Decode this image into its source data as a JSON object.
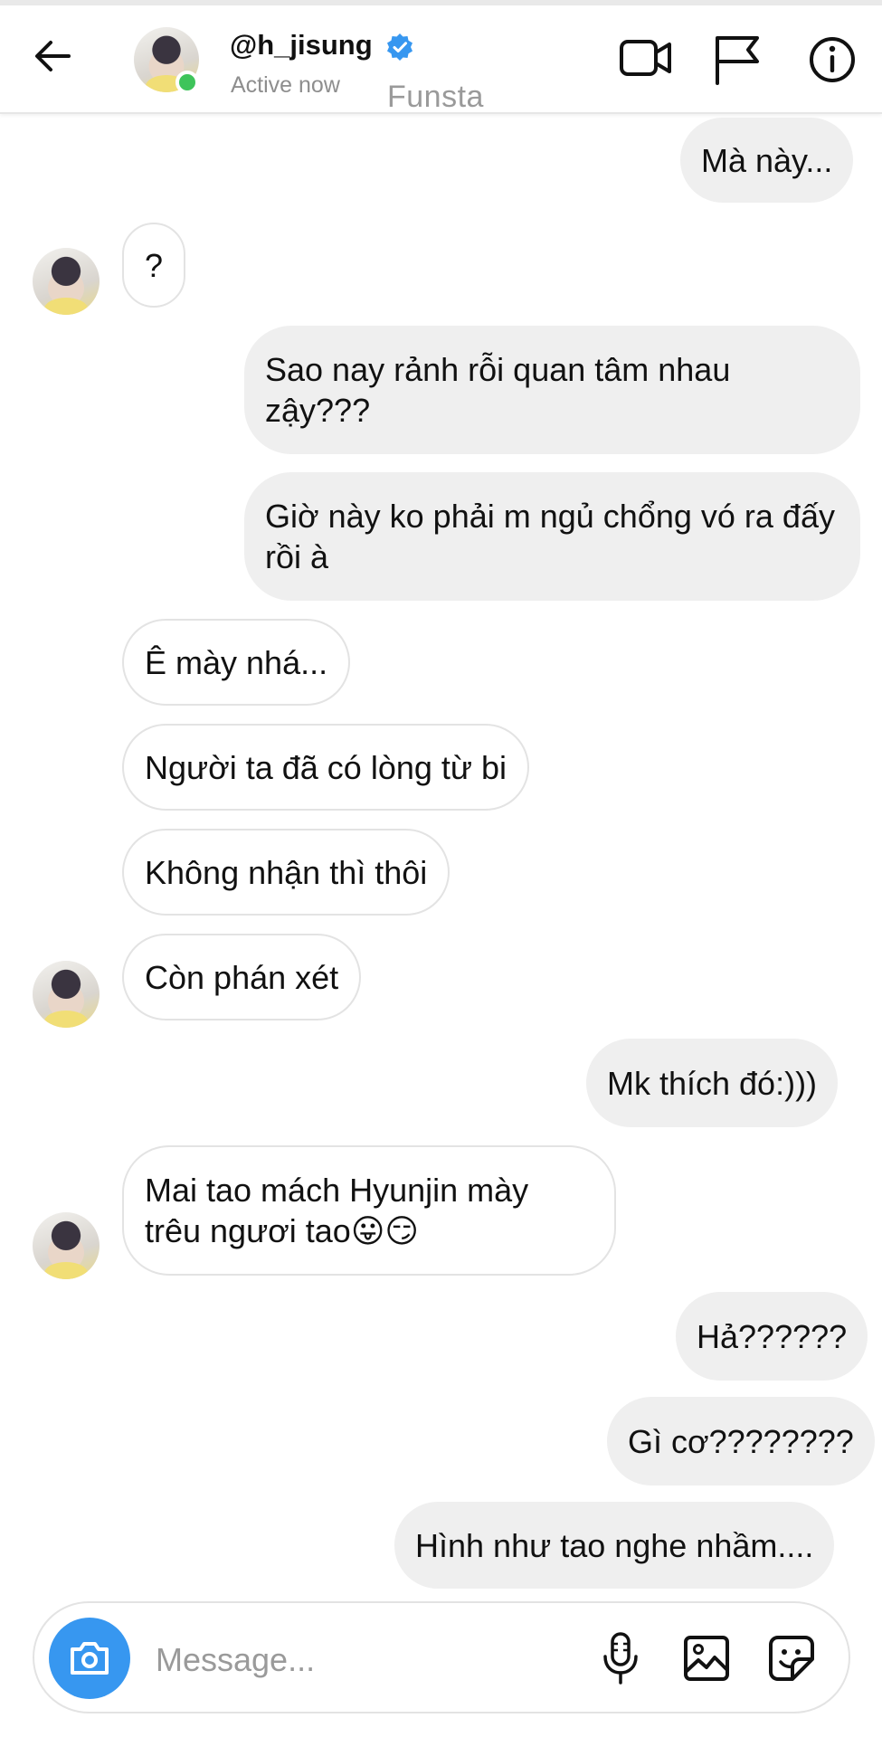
{
  "header": {
    "username": "@h_jisung",
    "status": "Active now",
    "note": "Funsta"
  },
  "messages": [
    {
      "side": "out",
      "text": "Mà này..."
    },
    {
      "side": "in",
      "text": "?"
    },
    {
      "side": "out",
      "text": "Sao nay rảnh rỗi quan tâm nhau zậy???"
    },
    {
      "side": "out",
      "text": "Giờ này ko phải m ngủ chổng vó ra đấy rồi à"
    },
    {
      "side": "in",
      "text": "Ê mày nhá..."
    },
    {
      "side": "in",
      "text": "Người ta đã có lòng từ bi"
    },
    {
      "side": "in",
      "text": "Không nhận thì thôi"
    },
    {
      "side": "in",
      "text": "Còn phán xét"
    },
    {
      "side": "out",
      "text": "Mk thích đó:)))"
    },
    {
      "side": "in",
      "text": "Mai tao mách Hyunjin mày trêu ngươi tao😛😏"
    },
    {
      "side": "out",
      "text": "Hả??????"
    },
    {
      "side": "out",
      "text": "Gì cơ????????"
    },
    {
      "side": "out",
      "text": "Hình như tao nghe nhầm...."
    }
  ],
  "composer": {
    "placeholder": "Message..."
  },
  "colors": {
    "accent": "#3797f0",
    "online": "#3ec45a",
    "verified": "#3797f0",
    "outgoing_bubble": "#efefef"
  },
  "icons": [
    "back-arrow-icon",
    "verified-badge-icon",
    "video-call-icon",
    "flag-icon",
    "info-icon",
    "camera-icon",
    "microphone-icon",
    "gallery-icon",
    "sticker-icon"
  ]
}
